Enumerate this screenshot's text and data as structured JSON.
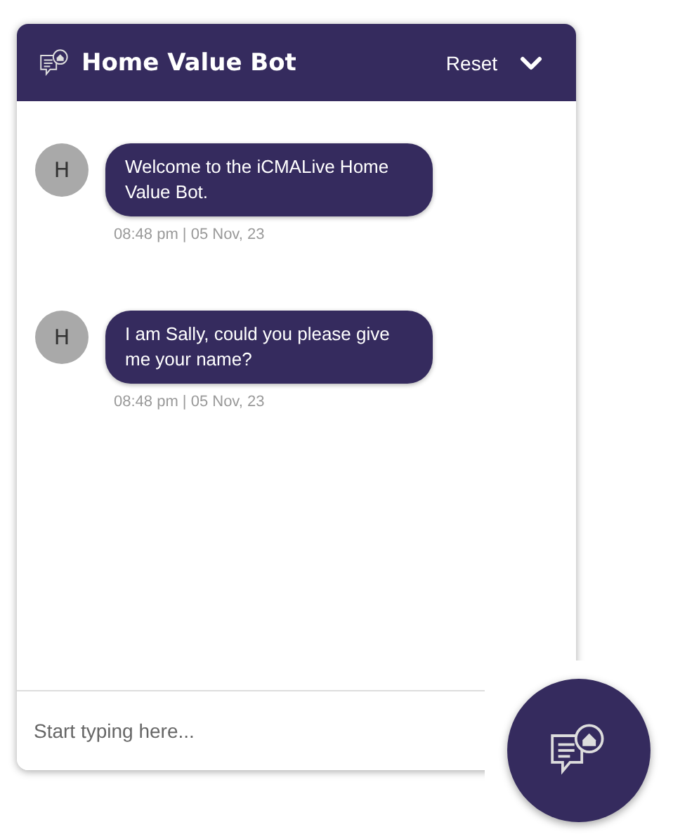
{
  "header": {
    "title": "Home Value Bot",
    "reset_label": "Reset"
  },
  "messages": [
    {
      "avatar": "H",
      "text": "Welcome to the iCMALive Home Value Bot.",
      "time": "08:48 pm | 05 Nov, 23"
    },
    {
      "avatar": "H",
      "text": "I am Sally, could you please give me your name?",
      "time": "08:48 pm | 05 Nov, 23"
    }
  ],
  "input": {
    "placeholder": "Start typing here..."
  }
}
